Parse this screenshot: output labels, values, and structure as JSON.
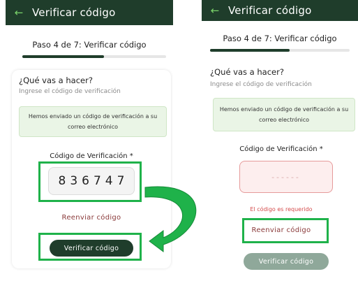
{
  "header": {
    "title": "Verificar código"
  },
  "step_text": "Paso 4 de 7: Verificar código",
  "progress": {
    "fraction": 0.57
  },
  "card": {
    "question": "¿Qué vas a hacer?",
    "subtitle": "Ingrese el código de verificación",
    "alert_line1": "Hemos enviado un código de verificación a su",
    "alert_line2": "correo electrónico",
    "code_label": "Código de Verificación *"
  },
  "left": {
    "code_value": "836747",
    "resend_label": "Reenviar código",
    "verify_label": "Verificar código"
  },
  "right": {
    "code_placeholder": "------",
    "error_text": "El código es requerido",
    "resend_label": "Reenviar código",
    "verify_label": "Verificar código"
  },
  "colors": {
    "appbar": "#1f3d2b",
    "highlight": "#1fb24a",
    "error": "#d44b4b",
    "button_enabled": "#1f3d2b",
    "button_disabled": "#8fa89a"
  }
}
